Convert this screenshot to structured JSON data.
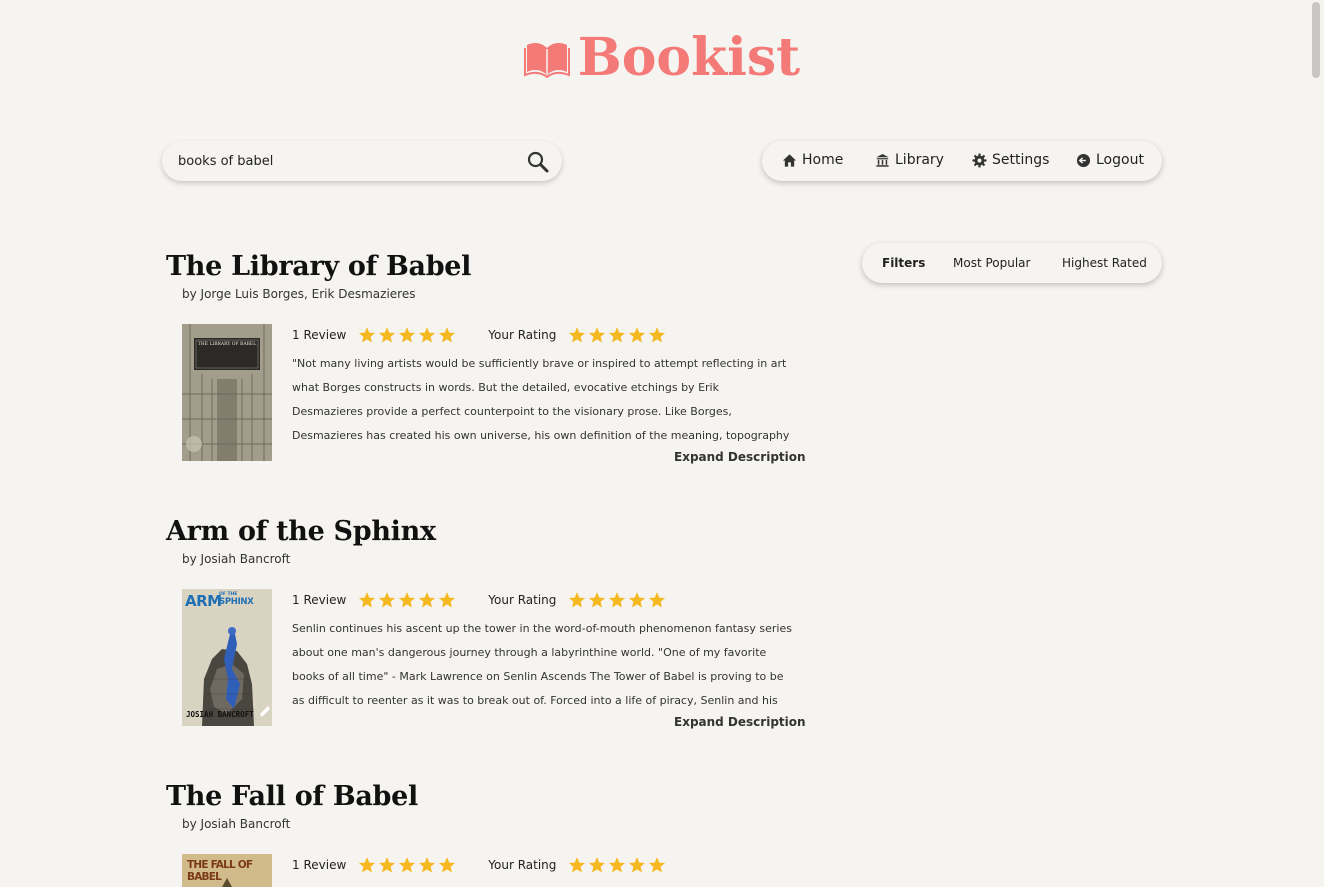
{
  "brand": {
    "name": "Bookist",
    "color": "#f47a78"
  },
  "search": {
    "value": "books of babel",
    "icon": "search-icon"
  },
  "nav": [
    {
      "label": "Home",
      "icon": "home-icon"
    },
    {
      "label": "Library",
      "icon": "library-icon"
    },
    {
      "label": "Settings",
      "icon": "gear-icon"
    },
    {
      "label": "Logout",
      "icon": "logout-icon"
    }
  ],
  "filters": [
    "Filters",
    "Most Popular",
    "Highest Rated"
  ],
  "books": [
    {
      "title": "The Library of Babel",
      "author": "by Jorge Luis Borges, Erik Desmazieres",
      "reviews": "1 Review",
      "rating": 5,
      "your_rating_label": "Your Rating",
      "your_rating": 5,
      "description": "\"Not many living artists would be sufficiently brave or inspired to attempt reflecting in art what Borges constructs in words. But the detailed, evocative etchings by Erik Desmazieres provide a perfect counterpoint to the visionary prose. Like Borges, Desmazieres has created his own universe, his own definition of the meaning, topography and geography of the Library of Babel.",
      "expand_label": "Expand Description",
      "cover_text": [
        "THE LIBRARY OF BABEL"
      ]
    },
    {
      "title": "Arm of the Sphinx",
      "author": "by Josiah Bancroft",
      "reviews": "1 Review",
      "rating": 5,
      "your_rating_label": "Your Rating",
      "your_rating": 5,
      "description": "Senlin continues his ascent up the tower in the word-of-mouth phenomenon fantasy series about one man's dangerous journey through a labyrinthine world. \"One of my favorite books of all time\" - Mark Lawrence on Senlin Ascends The Tower of Babel is proving to be as difficult to reenter as it was to break out of. Forced into a life of piracy, Senlin and his eclectic crew are",
      "expand_label": "Expand Description",
      "cover_text": [
        "ARM",
        "OF THE",
        "SPHINX",
        "JOSIAH BANCROFT"
      ]
    },
    {
      "title": "The Fall of Babel",
      "author": "by Josiah Bancroft",
      "reviews": "1 Review",
      "rating": 5,
      "your_rating_label": "Your Rating",
      "your_rating": 5,
      "description": "",
      "expand_label": "",
      "cover_text": [
        "THE FALL OF BABEL"
      ]
    }
  ],
  "colors": {
    "star": "#f5b820",
    "background": "#f6f4f0"
  }
}
